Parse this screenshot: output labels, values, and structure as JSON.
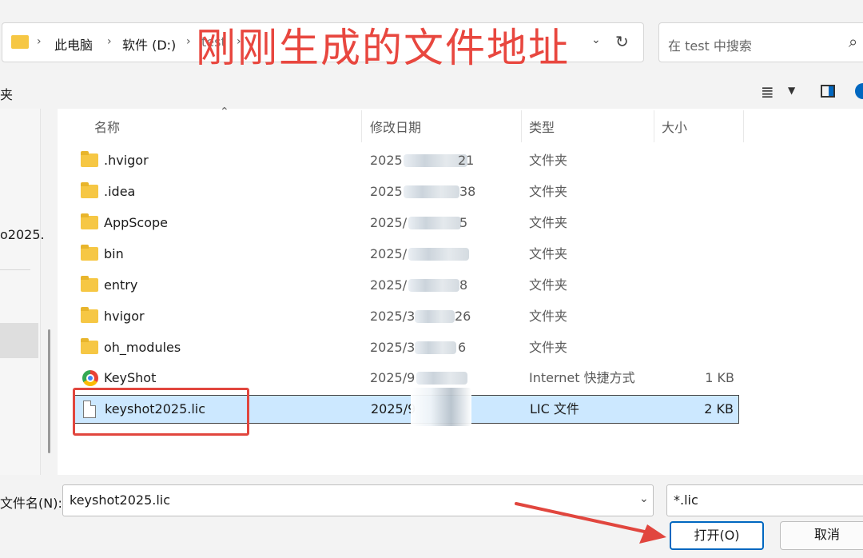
{
  "address_bar": {
    "breadcrumbs": [
      "此电脑",
      "软件 (D:)",
      "test"
    ],
    "refresh_icon": "refresh-icon"
  },
  "search": {
    "placeholder": "在 test 中搜索"
  },
  "annotation": {
    "text": "刚刚生成的文件地址",
    "color": "#e8473f"
  },
  "toolbar": {
    "left_fragment": "夹"
  },
  "nav": {
    "item_fragment": "o2025."
  },
  "columns": {
    "name": "名称",
    "date": "修改日期",
    "type": "类型",
    "size": "大小"
  },
  "files": [
    {
      "name": ".hvigor",
      "date_prefix": "2025",
      "date_suffix": "21",
      "type": "文件夹",
      "size": "",
      "icon": "folder-icon"
    },
    {
      "name": ".idea",
      "date_prefix": "2025",
      "date_suffix": "38",
      "type": "文件夹",
      "size": "",
      "icon": "folder-icon"
    },
    {
      "name": "AppScope",
      "date_prefix": "2025/",
      "date_suffix": "5",
      "type": "文件夹",
      "size": "",
      "icon": "folder-icon"
    },
    {
      "name": "bin",
      "date_prefix": "2025/",
      "date_suffix": "",
      "type": "文件夹",
      "size": "",
      "icon": "folder-icon"
    },
    {
      "name": "entry",
      "date_prefix": "2025/",
      "date_suffix": "8",
      "type": "文件夹",
      "size": "",
      "icon": "folder-icon"
    },
    {
      "name": "hvigor",
      "date_prefix": "2025/3",
      "date_suffix": "26",
      "type": "文件夹",
      "size": "",
      "icon": "folder-icon"
    },
    {
      "name": "oh_modules",
      "date_prefix": "2025/3",
      "date_suffix": "6",
      "type": "文件夹",
      "size": "",
      "icon": "folder-icon"
    },
    {
      "name": "KeyShot",
      "date_prefix": "2025/9",
      "date_suffix": "",
      "type": "Internet 快捷方式",
      "size": "1 KB",
      "icon": "chrome-shortcut-icon"
    },
    {
      "name": "keyshot2025.lic",
      "date_prefix": "2025/9",
      "date_suffix": "",
      "type": "LIC 文件",
      "size": "2 KB",
      "icon": "file-icon",
      "selected": true
    }
  ],
  "footer": {
    "filename_label": "文件名(N):",
    "filename_value": "keyshot2025.lic",
    "filetype_value": "*.lic",
    "open_label": "打开(O)",
    "cancel_label": "取消"
  },
  "colors": {
    "selection": "#cce8ff",
    "annotation_red": "#e1463e",
    "primary_border": "#0067c0"
  }
}
